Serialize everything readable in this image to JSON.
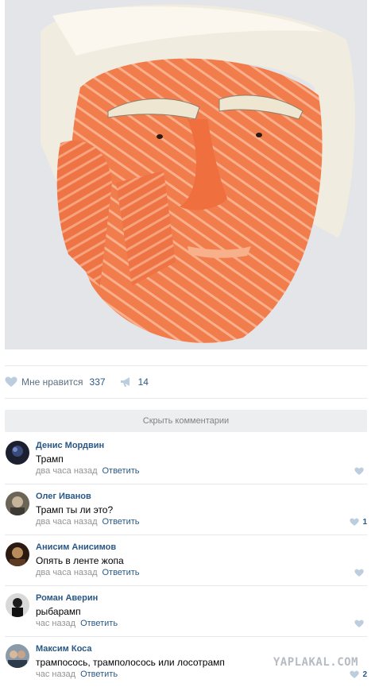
{
  "post": {
    "photo_alt": "",
    "likes_label": "Мне нравится",
    "likes_count": "337",
    "shares_count": "14"
  },
  "comments_toggle": "Скрыть комментарии",
  "reply_label": "Ответить",
  "comments": [
    {
      "author": "Денис Мордвин",
      "text": "Трамп",
      "time": "два часа назад",
      "likes": ""
    },
    {
      "author": "Олег Иванов",
      "text": "Трамп ты ли это?",
      "time": "два часа назад",
      "likes": "1"
    },
    {
      "author": "Анисим Анисимов",
      "text": "Опять в ленте жопа",
      "time": "два часа назад",
      "likes": ""
    },
    {
      "author": "Роман Аверин",
      "text": "рыбарамп",
      "time": "час назад",
      "likes": ""
    },
    {
      "author": "Максим Коса",
      "text": "трампосось, трамполосось или лосотрамп",
      "time": "час назад",
      "likes": "2"
    }
  ],
  "watermark": "YAPLAKAL.COM",
  "colors": {
    "link": "#2a5885",
    "muted": "#939393",
    "panel": "#edeef0",
    "salmon": "#f07c4e"
  },
  "icons": [
    "heart-icon",
    "megaphone-icon"
  ]
}
